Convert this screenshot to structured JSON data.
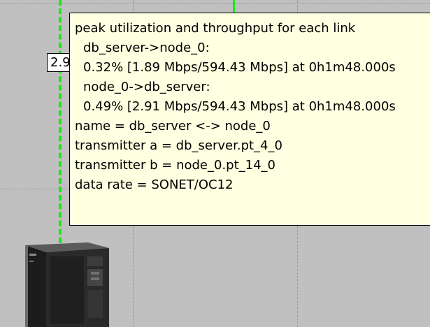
{
  "link_rate_label": "2.9",
  "tooltip": {
    "heading": "peak utilization and throughput for each link",
    "direction_1": "db_server->node_0:",
    "direction_1_stats": "0.32% [1.89 Mbps/594.43 Mbps] at 0h1m48.000s",
    "direction_2": "node_0->db_server:",
    "direction_2_stats": "0.49% [2.91 Mbps/594.43 Mbps] at 0h1m48.000s",
    "name": "name = db_server <-> node_0",
    "transmitter_a": "transmitter a = db_server.pt_4_0",
    "transmitter_b": "transmitter b = node_0.pt_14_0",
    "data_rate": "data rate = SONET/OC12"
  },
  "colors": {
    "canvas_background": "#c0c0c0",
    "link_color": "#18e818",
    "tooltip_background": "#ffffe1"
  },
  "icons": {
    "server": "server-tower-icon"
  }
}
